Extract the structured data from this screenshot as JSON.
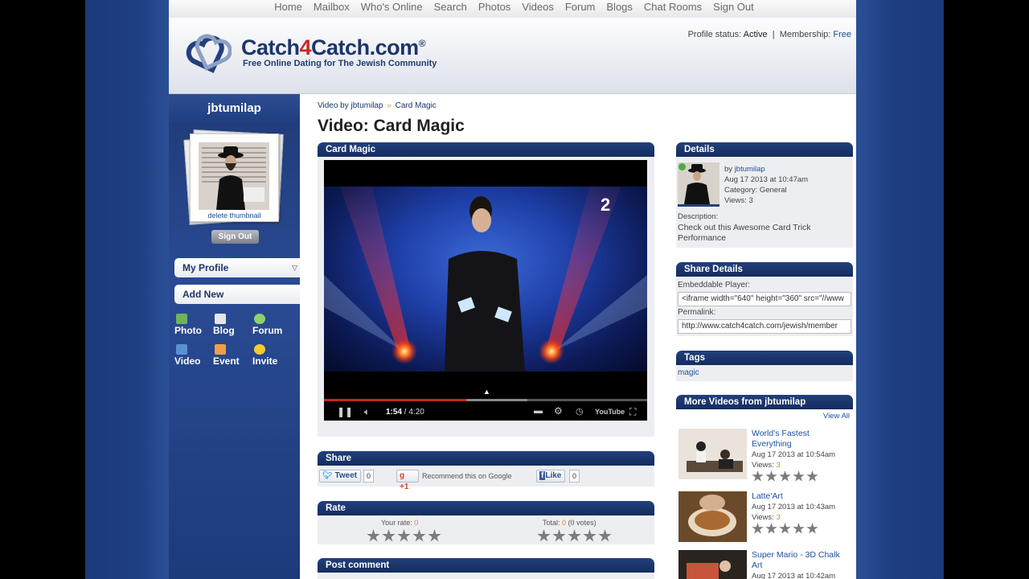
{
  "nav": [
    "Home",
    "Mailbox",
    "Who's Online",
    "Search",
    "Photos",
    "Videos",
    "Forum",
    "Blogs",
    "Chat Rooms",
    "Sign Out"
  ],
  "brand": {
    "name_pre": "Catch",
    "name_num": "4",
    "name_post": "Catch",
    "name_tld": ".com",
    "reg": "®",
    "tagline": "Free Online Dating for The Jewish Community"
  },
  "profile_status": {
    "status_label": "Profile status:",
    "status_value": "Active",
    "sep": "|",
    "membership_label": "Membership:",
    "membership_value": "Free"
  },
  "sidebar": {
    "username": "jbtumilap",
    "delete_thumbnail": "delete thumbnail",
    "sign_out": "Sign Out",
    "my_profile": "My Profile",
    "add_new": "Add New",
    "add_items": [
      "Photo",
      "Blog",
      "Forum",
      "Video",
      "Event",
      "Invite"
    ]
  },
  "breadcrumb": {
    "parent": "Video by jbtumilap",
    "sep": "»",
    "current": "Card Magic"
  },
  "page_title": "Video: Card Magic",
  "video": {
    "panel_title": "Card Magic",
    "time_current": "1:54",
    "time_total": " / 4:20",
    "played_fraction": 0.44,
    "buffered_fraction": 0.63,
    "channel_logo": "2",
    "yt_label": "YouTube"
  },
  "share": {
    "title": "Share",
    "tweet": "Tweet",
    "tweet_count": "0",
    "gplus": "+1",
    "gplus_text": "Recommend this on Google",
    "like": "Like",
    "like_count": "0"
  },
  "rate": {
    "title": "Rate",
    "your_rate_label": "Your rate:",
    "your_rate_value": "0",
    "total_label": "Total:",
    "total_value": "0",
    "total_votes": "(0 votes)"
  },
  "post_comment": {
    "title": "Post comment"
  },
  "details": {
    "title": "Details",
    "by_label": "by ",
    "by_user": "jbtumilap",
    "date": "Aug 17 2013 at 10:47am",
    "category": "Category: General",
    "views": "Views: 3",
    "description_label": "Description:",
    "description": "Check out this Awesome Card Trick Performance"
  },
  "share_details": {
    "title": "Share Details",
    "embed_label": "Embeddable Player:",
    "embed_value": "<iframe width=\"640\" height=\"360\" src=\"//www",
    "permalink_label": "Permalink:",
    "permalink_value": "http://www.catch4catch.com/jewish/member"
  },
  "tags": {
    "title": "Tags",
    "items": [
      "magic"
    ]
  },
  "more_videos": {
    "title": "More Videos from jbtumilap",
    "view_all": "View All",
    "items": [
      {
        "title": "World's Fastest Everything",
        "date": "Aug 17 2013 at 10:54am",
        "views_label": "Views: ",
        "views": "3"
      },
      {
        "title": "Latte'Art",
        "date": "Aug 17 2013 at 10:43am",
        "views_label": "Views: ",
        "views": "3"
      },
      {
        "title": "Super Mario - 3D Chalk Art",
        "date": "Aug 17 2013 at 10:42am"
      }
    ]
  },
  "colors": {
    "navy": "#142c5e",
    "accent": "#c6292c",
    "link": "#1f50a0",
    "orange": "#e08a2a"
  }
}
